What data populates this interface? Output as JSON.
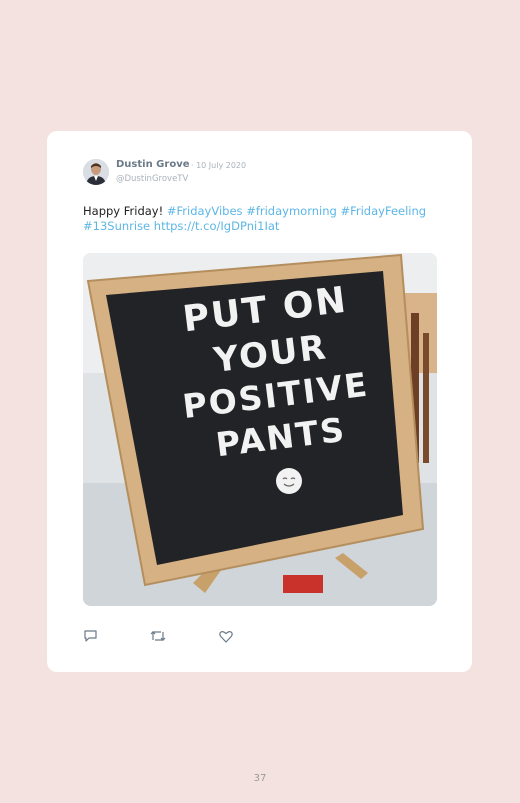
{
  "tweet": {
    "author_name": "Dustin Grove",
    "date": "· 10 July 2020",
    "handle": "@DustinGroveTV",
    "text_plain": "Happy Friday! ",
    "hashtags": [
      "#FridayVibes",
      "#fridaymorning",
      "#FridayFeeling",
      "#13Sunrise"
    ],
    "link": "https://t.co/IgDPni1Iat",
    "image_sign_lines": [
      "PUT ON",
      "YOUR",
      "POSITIVE",
      "PANTS"
    ]
  },
  "actions": {
    "icons": [
      "reply-icon",
      "retweet-icon",
      "like-icon"
    ]
  },
  "colors": {
    "page_background": "#f4e2e1",
    "card_background": "#ffffff",
    "link": "#5cb6e6",
    "name": "#6b7a87",
    "meta": "#a9b2ba"
  },
  "page": {
    "number": "37"
  }
}
